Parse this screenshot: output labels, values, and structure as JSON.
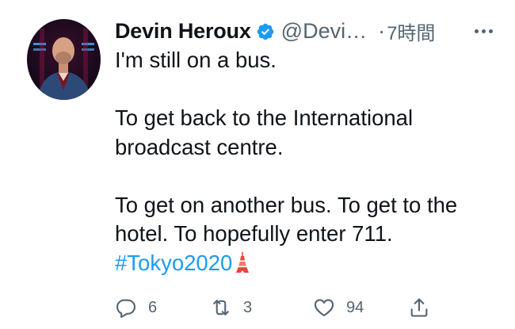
{
  "tweet": {
    "author": {
      "display_name": "Devin Heroux",
      "handle": "@Devi…",
      "verified_icon": "verified-badge-icon"
    },
    "separator": "·",
    "time": "7時間",
    "more_icon": "more-horizontal-icon",
    "text_lines": {
      "l1": "I'm still on a bus.",
      "l2": "To get back to the International",
      "l3": "broadcast centre.",
      "l4": "To get on another bus. To get to the",
      "l5": "hotel. To hopefully enter 711."
    },
    "hashtag": "#Tokyo2020",
    "emoji": "tokyo-tower-icon",
    "actions": {
      "reply": {
        "icon": "reply-icon",
        "count": "6"
      },
      "retweet": {
        "icon": "retweet-icon",
        "count": "3"
      },
      "like": {
        "icon": "heart-icon",
        "count": "94"
      },
      "share": {
        "icon": "share-icon",
        "count": ""
      }
    }
  },
  "colors": {
    "text": "#0f1419",
    "secondary": "#536471",
    "link": "#1d9bf0",
    "verified": "#1d9bf0"
  }
}
